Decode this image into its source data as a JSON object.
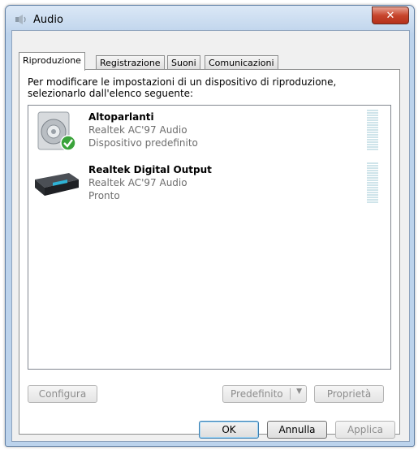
{
  "window": {
    "title": "Audio"
  },
  "tabs": [
    "Riproduzione",
    "Registrazione",
    "Suoni",
    "Comunicazioni"
  ],
  "instructions": "Per modificare le impostazioni di un dispositivo di riproduzione, selezionarlo dall'elenco seguente:",
  "devices": [
    {
      "name": "Altoparlanti",
      "driver": "Realtek AC'97 Audio",
      "status": "Dispositivo predefinito",
      "icon": "speaker-icon",
      "is_default": true
    },
    {
      "name": "Realtek Digital Output",
      "driver": "Realtek AC'97 Audio",
      "status": "Pronto",
      "icon": "digital-output-icon",
      "is_default": false
    }
  ],
  "buttons": {
    "configure": "Configura",
    "set_default": "Predefinito",
    "properties": "Proprietà",
    "ok": "OK",
    "cancel": "Annulla",
    "apply": "Applica"
  },
  "colors": {
    "accent": "#3c7fb1",
    "close": "#c7452d",
    "default_check": "#3aa33a"
  }
}
